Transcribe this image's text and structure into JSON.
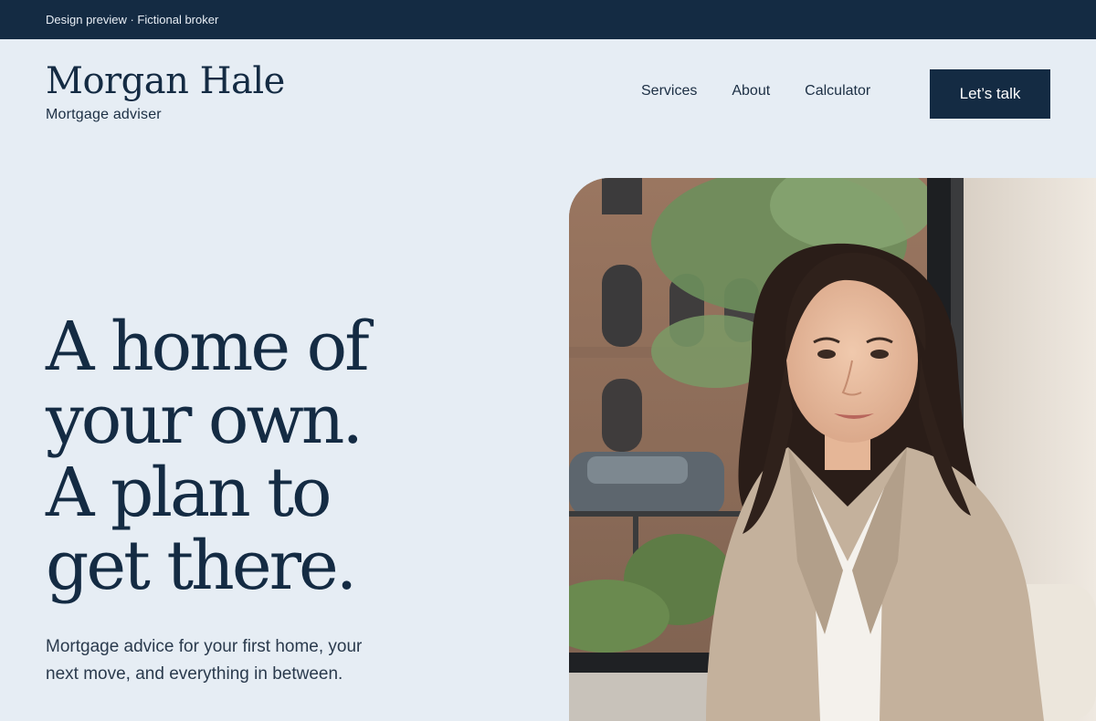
{
  "topbar": {
    "text": "Design preview · Fictional broker"
  },
  "brand": {
    "name": "Morgan Hale",
    "subtitle": "Mortgage adviser"
  },
  "nav": {
    "items": [
      {
        "label": "Services"
      },
      {
        "label": "About"
      },
      {
        "label": "Calculator"
      }
    ],
    "cta_label": "Let’s talk"
  },
  "hero": {
    "headline_lines": [
      "A home of",
      "your own.",
      "A plan to",
      "get there."
    ],
    "lede": "Mortgage advice for your first home, your next move, and everything in between."
  },
  "colors": {
    "background": "#e6edf4",
    "navy": "#142b43",
    "text": "#1c2f44"
  },
  "image": {
    "icon": "portrait-photo",
    "subject": "adviser-portrait"
  }
}
